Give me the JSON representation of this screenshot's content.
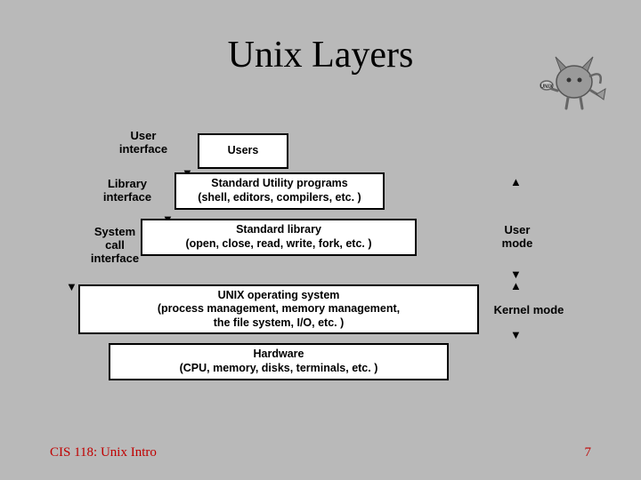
{
  "title": "Unix Layers",
  "interfaces": {
    "user": "User\ninterface",
    "library": "Library\ninterface",
    "syscall": "System\ncall\ninterface"
  },
  "layers": {
    "users": "Users",
    "utilities": "Standard Utility programs\n(shell, editors, compilers, etc. )",
    "stdlib": "Standard library\n(open, close, read, write, fork, etc. )",
    "os": "UNIX operating system\n(process management, memory management,\nthe file system, I/O, etc. )",
    "hardware": "Hardware\n(CPU, memory, disks, terminals, etc. )"
  },
  "modes": {
    "user": "User\nmode",
    "kernel": "Kernel mode"
  },
  "footer": {
    "left": "CIS 118: Unix Intro",
    "right": "7"
  }
}
